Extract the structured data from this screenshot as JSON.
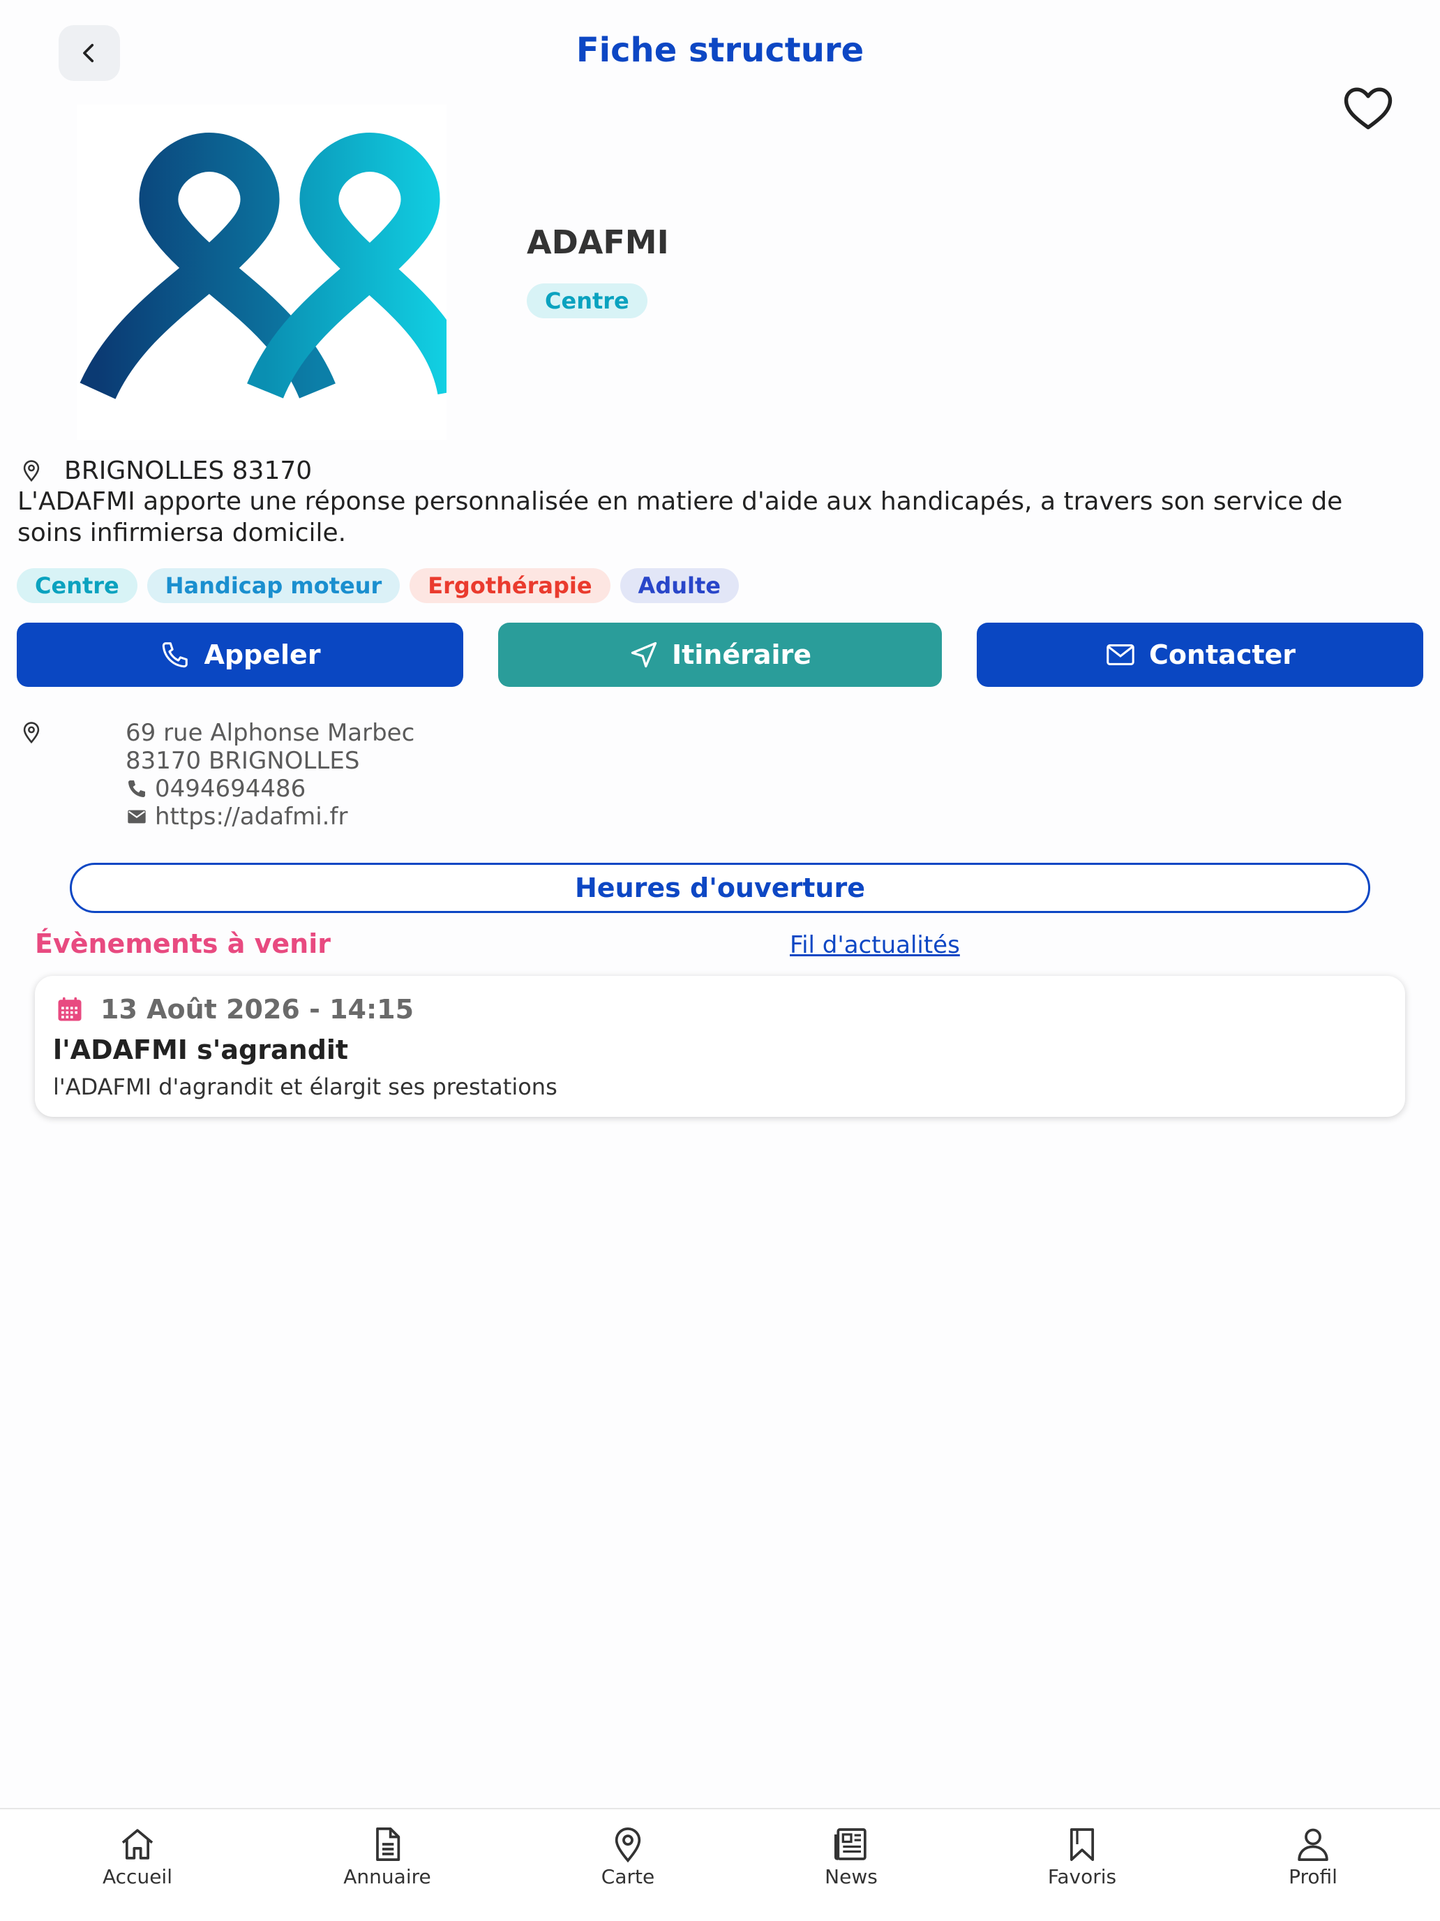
{
  "header": {
    "title": "Fiche structure"
  },
  "organization": {
    "name": "ADAFMI",
    "type_tag": "Centre",
    "location": "BRIGNOLLES 83170",
    "description": "L'ADAFMI apporte une réponse personnalisée en matiere d'aide aux handicapés, a travers son service de soins infirmiersa domicile.",
    "tags": [
      "Centre",
      "Handicap moteur",
      "Ergothérapie",
      "Adulte"
    ]
  },
  "actions": {
    "call": "Appeler",
    "route": "Itinéraire",
    "contact": "Contacter"
  },
  "contact": {
    "street": "69 rue Alphonse Marbec",
    "city": "83170 BRIGNOLLES",
    "phone": "0494694486",
    "website": "https://adafmi.fr"
  },
  "hours_button": "Heures d'ouverture",
  "events": {
    "title": "Évènements à venir",
    "news_link": "Fil d'actualités",
    "items": [
      {
        "date": "13 Août 2026 - 14:15",
        "title": "l'ADAFMI s'agrandit",
        "description": "l'ADAFMI d'agrandit et élargit ses prestations"
      }
    ]
  },
  "tabbar": [
    "Accueil",
    "Annuaire",
    "Carte",
    "News",
    "Favoris",
    "Profil"
  ],
  "colors": {
    "primary": "#0d47c4",
    "teal": "#2a9d9a",
    "pink": "#e84a80",
    "logo_dark": "#0b3a73",
    "logo_light": "#12d4e6"
  }
}
